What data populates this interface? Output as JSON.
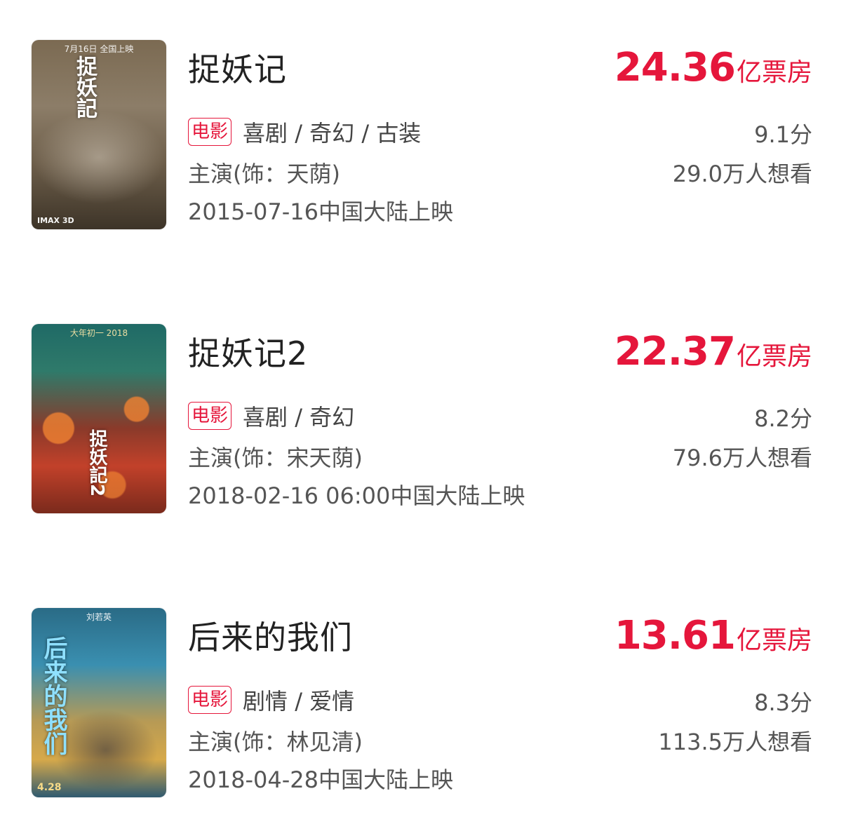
{
  "movies": [
    {
      "title": "捉妖记",
      "boxoffice_value": "24.36",
      "boxoffice_unit": "亿票房",
      "tag": "电影",
      "genres": "喜剧 / 奇幻 / 古装",
      "actor": "主演(饰：天荫)",
      "release": "2015-07-16中国大陆上映",
      "score": "9.1分",
      "wish": "29.0万人想看",
      "poster": {
        "title_text": "捉妖記",
        "top_text": "7月16日 全国上映",
        "bottom_text": "IMAX 3D",
        "colors": [
          "#5a4a3a",
          "#8a7a66",
          "#3d3428"
        ]
      }
    },
    {
      "title": "捉妖记2",
      "boxoffice_value": "22.37",
      "boxoffice_unit": "亿票房",
      "tag": "电影",
      "genres": "喜剧 / 奇幻",
      "actor": "主演(饰：宋天荫)",
      "release": "2018-02-16 06:00中国大陆上映",
      "score": "8.2分",
      "wish": "79.6万人想看",
      "poster": {
        "title_text": "捉妖記2",
        "top_text": "大年初一 2018",
        "bottom_text": "",
        "colors": [
          "#1f6a66",
          "#c2412a",
          "#7a2a1c"
        ]
      }
    },
    {
      "title": "后来的我们",
      "boxoffice_value": "13.61",
      "boxoffice_unit": "亿票房",
      "tag": "电影",
      "genres": "剧情 / 爱情",
      "actor": "主演(饰：林见清)",
      "release": "2018-04-28中国大陆上映",
      "score": "8.3分",
      "wish": "113.5万人想看",
      "poster": {
        "title_text": "后来的我们",
        "top_text": "刘若英",
        "bottom_text": "4.28",
        "colors": [
          "#2a6b86",
          "#d6a94a",
          "#3a8fb0"
        ]
      }
    }
  ]
}
